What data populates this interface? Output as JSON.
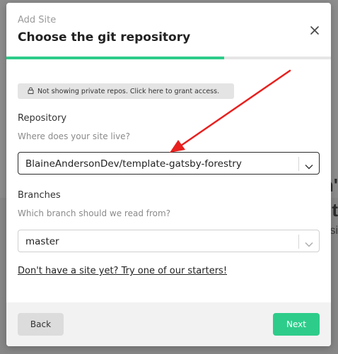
{
  "background": {
    "text_1": "n'",
    "text_2": "t",
    "text_3": "si"
  },
  "modal": {
    "subtitle": "Add Site",
    "title": "Choose the git repository",
    "progress": 0.67,
    "notice": "Not showing private repos. Click here to grant access.",
    "repository": {
      "label": "Repository",
      "hint": "Where does your site live?",
      "value": "BlaineAndersonDev/template-gatsby-forestry"
    },
    "branches": {
      "label": "Branches",
      "hint": "Which branch should we read from?",
      "value": "master"
    },
    "starter_link": "Don't have a site yet? Try one of our starters!",
    "back_label": "Back",
    "next_label": "Next"
  },
  "colors": {
    "accent": "#2ecc8a",
    "annotation_arrow": "#e8201e"
  }
}
